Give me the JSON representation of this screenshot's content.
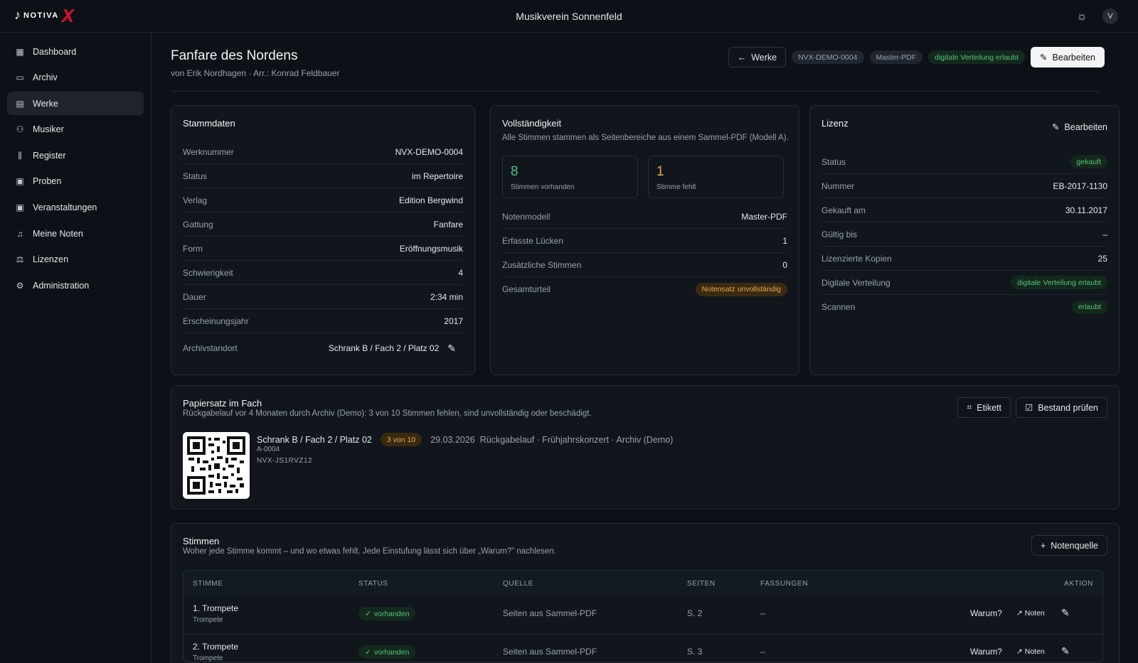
{
  "app": {
    "logo_text": "NOTIVA",
    "logo_mark": "X",
    "title": "Musikverein Sonnenfeld",
    "avatar_letter": "V",
    "theme_icon": "sun-icon"
  },
  "sidebar": {
    "items": [
      {
        "label": "Dashboard",
        "icon": "grid-icon"
      },
      {
        "label": "Archiv",
        "icon": "archive-icon"
      },
      {
        "label": "Werke",
        "icon": "file-music-icon",
        "active": true
      },
      {
        "label": "Musiker",
        "icon": "users-icon"
      },
      {
        "label": "Register",
        "icon": "library-icon"
      },
      {
        "label": "Proben",
        "icon": "calendar-icon"
      },
      {
        "label": "Veranstaltungen",
        "icon": "calendar-event-icon"
      },
      {
        "label": "Meine Noten",
        "icon": "music-note-icon"
      },
      {
        "label": "Lizenzen",
        "icon": "scale-icon"
      },
      {
        "label": "Administration",
        "icon": "gear-icon"
      }
    ]
  },
  "header": {
    "title": "Fanfare des Nordens",
    "subtitle": "von Erik Nordhagen · Arr.: Konrad Feldbauer",
    "back_label": "Werke",
    "badges": [
      "NVX-DEMO-0004",
      "Master-PDF",
      "digitale Verteilung erlaubt"
    ],
    "edit_label": "Bearbeiten"
  },
  "stammdaten": {
    "title": "Stammdaten",
    "rows": [
      {
        "k": "Werknummer",
        "v": "NVX-DEMO-0004"
      },
      {
        "k": "Status",
        "v": "im Repertoire"
      },
      {
        "k": "Verlag",
        "v": "Edition Bergwind"
      },
      {
        "k": "Gattung",
        "v": "Fanfare"
      },
      {
        "k": "Form",
        "v": "Eröffnungsmusik"
      },
      {
        "k": "Schwierigkeit",
        "v": "4"
      },
      {
        "k": "Dauer",
        "v": "2:34 min"
      },
      {
        "k": "Erscheinungsjahr",
        "v": "2017"
      },
      {
        "k": "Archivstandort",
        "v": "Schrank B / Fach 2 / Platz 02"
      }
    ]
  },
  "vollstaendigkeit": {
    "title": "Vollständigkeit",
    "desc": "Alle Stimmen stammen als Seitenbereiche aus einem Sammel-PDF (Modell A).",
    "present_num": "8",
    "present_label": "Stimmen vorhanden",
    "missing_num": "1",
    "missing_label": "Stimme fehlt",
    "rows": [
      {
        "k": "Notenmodell",
        "v": "Master-PDF"
      },
      {
        "k": "Erfasste Lücken",
        "v": "1"
      },
      {
        "k": "Zusätzliche Stimmen",
        "v": "0"
      }
    ],
    "verdict_label": "Gesamturteil",
    "verdict": "Notensatz unvollständig",
    "colors": {
      "present": "#56c27a",
      "missing": "#e6a84a"
    }
  },
  "lizenz": {
    "title": "Lizenz",
    "edit_label": "Bearbeiten",
    "status_label": "Status",
    "status": "gekauft",
    "rows": [
      {
        "k": "Nummer",
        "v": "EB-2017-1130"
      },
      {
        "k": "Gekauft am",
        "v": "30.11.2017"
      },
      {
        "k": "Gültig bis",
        "v": "–"
      },
      {
        "k": "Lizenzierte Kopien",
        "v": "25"
      }
    ],
    "digital_label": "Digitale Verteilung",
    "digital": "digitale Verteilung erlaubt",
    "scan_label": "Scannen",
    "scan": "erlaubt"
  },
  "papiersatz": {
    "title": "Papiersatz im Fach",
    "desc": "Rückgabelauf vor 4 Monaten durch Archiv (Demo): 3 von 10 Stimmen fehlen, sind unvollständig oder beschädigt.",
    "label_btn": "Etikett",
    "check_btn": "Bestand prüfen",
    "location": "Schrank B / Fach 2 / Platz 02",
    "count_badge": "3 von 10",
    "date": "29.03.2026",
    "event": "Rückgabelauf · Frühjahrskonzert · Archiv (Demo)",
    "code1": "A-0004",
    "code2": "NVX-JS1RVZ12"
  },
  "stimmen": {
    "title": "Stimmen",
    "desc": "Woher jede Stimme kommt – und wo etwas fehlt. Jede Einstufung lässt sich über „Warum?\" nachlesen.",
    "add_btn": "Notenquelle",
    "columns": [
      "STIMME",
      "STATUS",
      "QUELLE",
      "SEITEN",
      "FASSUNGEN",
      "AKTION"
    ],
    "rows": [
      {
        "name": "1. Trompete",
        "instrument": "Trompete",
        "status": "vorhanden",
        "source": "Seiten aus Sammel-PDF",
        "pages": "S. 2",
        "versions": "–",
        "why": "Warum?",
        "notes": "Noten"
      },
      {
        "name": "2. Trompete",
        "instrument": "Trompete",
        "status": "vorhanden",
        "source": "Seiten aus Sammel-PDF",
        "pages": "S. 3",
        "versions": "–",
        "why": "Warum?",
        "notes": "Noten"
      }
    ]
  }
}
